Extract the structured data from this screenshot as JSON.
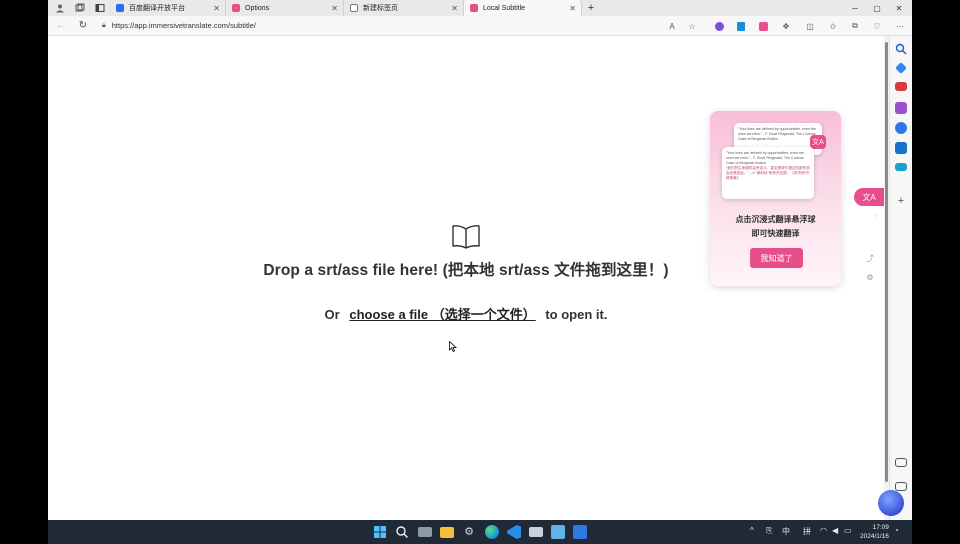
{
  "tabs": [
    {
      "title": "百度翻译开放平台",
      "color": "#2b6ff0"
    },
    {
      "title": "Options",
      "color": "#e64f8c"
    },
    {
      "title": "新建标签页",
      "color": "#777777"
    },
    {
      "title": "Local Subtitle",
      "color": "#e64f8c"
    }
  ],
  "address": {
    "url": "https://app.immersivetranslate.com/subtitle/"
  },
  "page": {
    "drop_text": "Drop a srt/ass file here! (把本地 srt/ass 文件拖到这里！)",
    "or_prefix": "Or",
    "choose_link": "choose a file （选择一个文件）",
    "or_suffix": "to open it."
  },
  "popup": {
    "card_back_text": "\"Your lives are defined by opportunities, even the ones we miss.\" - F. Scott Fitzgerald, The Curious Case of Benjamin Button",
    "card_front_en": "\"Your lives are defined by opportunities, even the ones we miss.\" - F. Scott Fitzgerald, The Curious Case of Benjamin Button.",
    "card_front_zh": "\"我们的生命被机会所定义，甚至是我们错过的那些机会也是如此。\" —F·斯科特·菲茨杰拉德，《本杰明·巴顿奇事》",
    "title_line1": "点击沉浸式翻译悬浮球",
    "title_line2": "即可快速翻译",
    "button": "我知道了"
  },
  "clock": {
    "time": "17:09",
    "date": "2024/1/16"
  },
  "tray": {
    "ime1": "中",
    "ime2": "拼"
  },
  "colors": {
    "accent": "#e64f8c",
    "taskbar": "#1f2a36"
  }
}
